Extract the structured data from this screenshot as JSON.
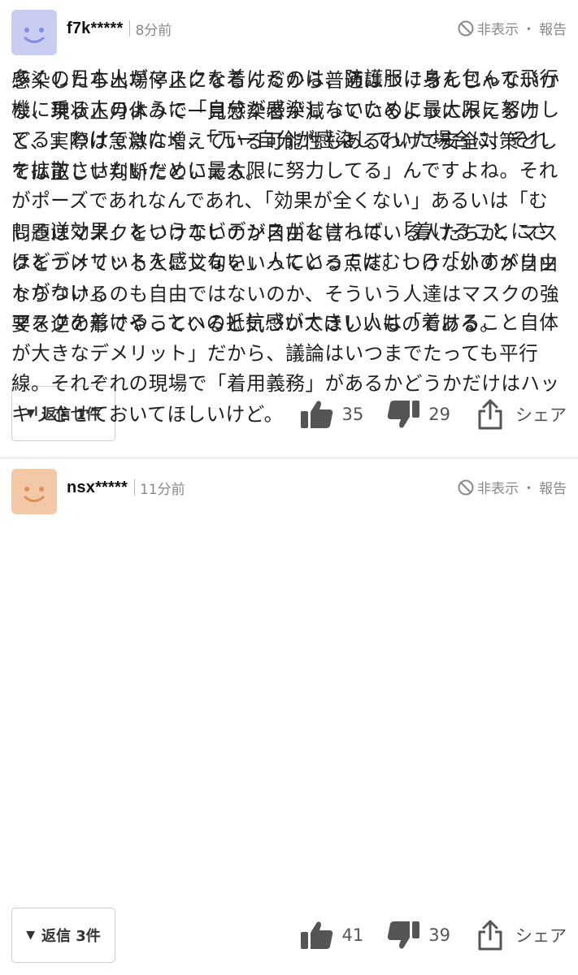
{
  "comments": [
    {
      "username": "f7k*****",
      "time": "8分前",
      "hide_label": "非表示",
      "dot": "・",
      "report_label": "報告",
      "body": "感染したら出場停止になるんだから普通はつけるんじゃないかな、現状正月休みで一見感染者が減っているようにみえるけど、実際は急激に増えている可能性もあるわけで安全対策としては正しい判断だといえる。\n\n問題はマスクをつけないのが自由と言っている人たちが、マスクをつけている人に文句をいっている点だ。つけないのが自由ならつけるのも自由ではないのか、そういう人達はマスクの強要を逆の形でやっていると気づいてほしいものである。",
      "reply_label": "返信 1件",
      "likes": "35",
      "dislikes": "29",
      "share_label": "シェア"
    },
    {
      "username": "nsx*****",
      "time": "11分前",
      "hide_label": "非表示",
      "dot": "・",
      "report_label": "報告",
      "body": "多くの日本人がマスクを着けるのは、防護服に身を包んで飛行機に乗る人のように「自分が感染しないために最大限に努力してる」わけではなく、「万一自分が感染していた場合に、それを拡散させないために最大限に努力してる」んですよね。それがポーズであれなんであれ、「効果が全くない」あるいは「むしろ逆効果」というエビデンスがなければ、「着けることにさほどデメリットを感じない」人にとってはむしろ「外すメリットがない」。\nマスクを着けることへの抵抗感が大きい人は「着けること自体が大きなデメリット」だから、議論はいつまでたっても平行線。それぞれの現場で「着用義務」があるかどうかだけはハッキリさせておいてほしいけど。",
      "reply_label": "返信 3件",
      "likes": "41",
      "dislikes": "39",
      "share_label": "シェア"
    }
  ],
  "colors": {
    "avatar_1": "#c9cdf1",
    "avatar_2": "#f3c8a6",
    "icon_gray": "#555555",
    "meta_gray": "#8a8a8a"
  }
}
